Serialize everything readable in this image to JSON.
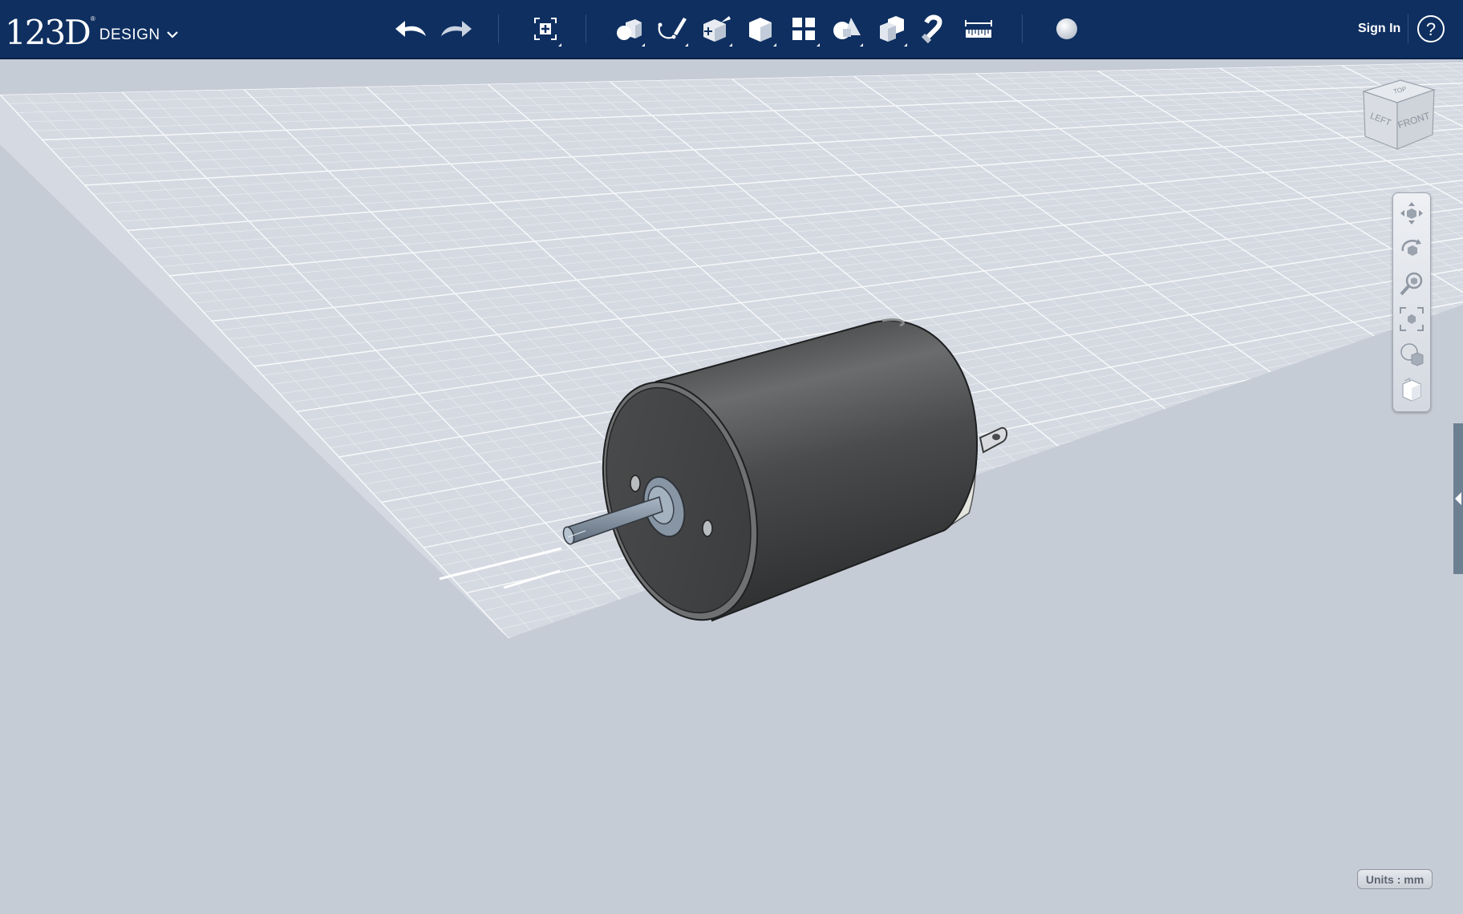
{
  "app": {
    "logo_number": "123D",
    "logo_word": "DESIGN",
    "logo_trademark": "®",
    "menu_icon": "chevron-down-icon"
  },
  "toolbar": {
    "tools": [
      {
        "name": "undo",
        "icon": "undo-arrow-icon"
      },
      {
        "name": "redo",
        "icon": "redo-arrow-icon"
      },
      {
        "name": "transform",
        "icon": "transform-icon"
      },
      {
        "name": "primitives",
        "icon": "primitives-icon"
      },
      {
        "name": "sketch",
        "icon": "sketch-icon"
      },
      {
        "name": "construct",
        "icon": "construct-icon"
      },
      {
        "name": "modify",
        "icon": "modify-icon"
      },
      {
        "name": "pattern",
        "icon": "pattern-icon"
      },
      {
        "name": "grouping",
        "icon": "grouping-icon"
      },
      {
        "name": "combine",
        "icon": "combine-icon"
      },
      {
        "name": "snap",
        "icon": "snap-magnet-icon"
      },
      {
        "name": "measure",
        "icon": "measure-ruler-icon"
      },
      {
        "name": "material",
        "icon": "material-sphere-icon"
      }
    ],
    "signin_label": "Sign In",
    "help_label": "?"
  },
  "viewcube": {
    "top_label": "TOP",
    "left_label": "LEFT",
    "front_label": "FRONT"
  },
  "nav_tools": [
    "pan-icon",
    "orbit-icon",
    "zoom-icon",
    "fit-icon",
    "visual-style-icon",
    "materials-icon"
  ],
  "status": {
    "units_label": "Units : mm"
  },
  "colors": {
    "toolbar_bg": "#0e2f60",
    "viewport_bg": "#c6ccd6",
    "grid_line": "#ffffff",
    "motor_body": "#3f4040",
    "shaft": "#8b9aa8"
  }
}
